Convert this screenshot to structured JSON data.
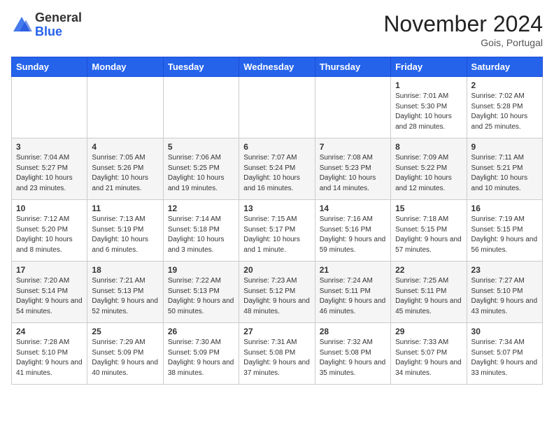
{
  "logo": {
    "general": "General",
    "blue": "Blue"
  },
  "header": {
    "month_year": "November 2024",
    "location": "Gois, Portugal"
  },
  "weekdays": [
    "Sunday",
    "Monday",
    "Tuesday",
    "Wednesday",
    "Thursday",
    "Friday",
    "Saturday"
  ],
  "weeks": [
    [
      {
        "day": "",
        "info": ""
      },
      {
        "day": "",
        "info": ""
      },
      {
        "day": "",
        "info": ""
      },
      {
        "day": "",
        "info": ""
      },
      {
        "day": "",
        "info": ""
      },
      {
        "day": "1",
        "info": "Sunrise: 7:01 AM\nSunset: 5:30 PM\nDaylight: 10 hours and 28 minutes."
      },
      {
        "day": "2",
        "info": "Sunrise: 7:02 AM\nSunset: 5:28 PM\nDaylight: 10 hours and 25 minutes."
      }
    ],
    [
      {
        "day": "3",
        "info": "Sunrise: 7:04 AM\nSunset: 5:27 PM\nDaylight: 10 hours and 23 minutes."
      },
      {
        "day": "4",
        "info": "Sunrise: 7:05 AM\nSunset: 5:26 PM\nDaylight: 10 hours and 21 minutes."
      },
      {
        "day": "5",
        "info": "Sunrise: 7:06 AM\nSunset: 5:25 PM\nDaylight: 10 hours and 19 minutes."
      },
      {
        "day": "6",
        "info": "Sunrise: 7:07 AM\nSunset: 5:24 PM\nDaylight: 10 hours and 16 minutes."
      },
      {
        "day": "7",
        "info": "Sunrise: 7:08 AM\nSunset: 5:23 PM\nDaylight: 10 hours and 14 minutes."
      },
      {
        "day": "8",
        "info": "Sunrise: 7:09 AM\nSunset: 5:22 PM\nDaylight: 10 hours and 12 minutes."
      },
      {
        "day": "9",
        "info": "Sunrise: 7:11 AM\nSunset: 5:21 PM\nDaylight: 10 hours and 10 minutes."
      }
    ],
    [
      {
        "day": "10",
        "info": "Sunrise: 7:12 AM\nSunset: 5:20 PM\nDaylight: 10 hours and 8 minutes."
      },
      {
        "day": "11",
        "info": "Sunrise: 7:13 AM\nSunset: 5:19 PM\nDaylight: 10 hours and 6 minutes."
      },
      {
        "day": "12",
        "info": "Sunrise: 7:14 AM\nSunset: 5:18 PM\nDaylight: 10 hours and 3 minutes."
      },
      {
        "day": "13",
        "info": "Sunrise: 7:15 AM\nSunset: 5:17 PM\nDaylight: 10 hours and 1 minute."
      },
      {
        "day": "14",
        "info": "Sunrise: 7:16 AM\nSunset: 5:16 PM\nDaylight: 9 hours and 59 minutes."
      },
      {
        "day": "15",
        "info": "Sunrise: 7:18 AM\nSunset: 5:15 PM\nDaylight: 9 hours and 57 minutes."
      },
      {
        "day": "16",
        "info": "Sunrise: 7:19 AM\nSunset: 5:15 PM\nDaylight: 9 hours and 56 minutes."
      }
    ],
    [
      {
        "day": "17",
        "info": "Sunrise: 7:20 AM\nSunset: 5:14 PM\nDaylight: 9 hours and 54 minutes."
      },
      {
        "day": "18",
        "info": "Sunrise: 7:21 AM\nSunset: 5:13 PM\nDaylight: 9 hours and 52 minutes."
      },
      {
        "day": "19",
        "info": "Sunrise: 7:22 AM\nSunset: 5:13 PM\nDaylight: 9 hours and 50 minutes."
      },
      {
        "day": "20",
        "info": "Sunrise: 7:23 AM\nSunset: 5:12 PM\nDaylight: 9 hours and 48 minutes."
      },
      {
        "day": "21",
        "info": "Sunrise: 7:24 AM\nSunset: 5:11 PM\nDaylight: 9 hours and 46 minutes."
      },
      {
        "day": "22",
        "info": "Sunrise: 7:25 AM\nSunset: 5:11 PM\nDaylight: 9 hours and 45 minutes."
      },
      {
        "day": "23",
        "info": "Sunrise: 7:27 AM\nSunset: 5:10 PM\nDaylight: 9 hours and 43 minutes."
      }
    ],
    [
      {
        "day": "24",
        "info": "Sunrise: 7:28 AM\nSunset: 5:10 PM\nDaylight: 9 hours and 41 minutes."
      },
      {
        "day": "25",
        "info": "Sunrise: 7:29 AM\nSunset: 5:09 PM\nDaylight: 9 hours and 40 minutes."
      },
      {
        "day": "26",
        "info": "Sunrise: 7:30 AM\nSunset: 5:09 PM\nDaylight: 9 hours and 38 minutes."
      },
      {
        "day": "27",
        "info": "Sunrise: 7:31 AM\nSunset: 5:08 PM\nDaylight: 9 hours and 37 minutes."
      },
      {
        "day": "28",
        "info": "Sunrise: 7:32 AM\nSunset: 5:08 PM\nDaylight: 9 hours and 35 minutes."
      },
      {
        "day": "29",
        "info": "Sunrise: 7:33 AM\nSunset: 5:07 PM\nDaylight: 9 hours and 34 minutes."
      },
      {
        "day": "30",
        "info": "Sunrise: 7:34 AM\nSunset: 5:07 PM\nDaylight: 9 hours and 33 minutes."
      }
    ]
  ]
}
